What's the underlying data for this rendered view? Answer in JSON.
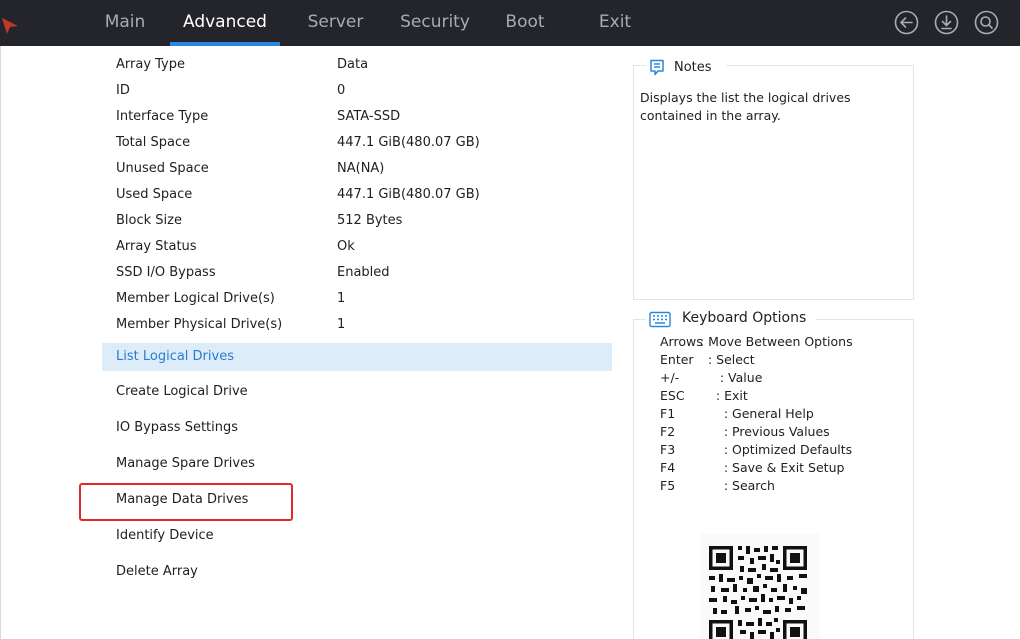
{
  "nav": {
    "tabs": [
      {
        "label": "Main",
        "active": false
      },
      {
        "label": "Advanced",
        "active": true
      },
      {
        "label": "Server",
        "active": false
      },
      {
        "label": "Security",
        "active": false
      },
      {
        "label": "Boot",
        "active": false
      },
      {
        "label": "Exit",
        "active": false
      }
    ],
    "icons": [
      "back-icon",
      "download-icon",
      "search-icon"
    ],
    "accent": "#2b86e0"
  },
  "info": [
    {
      "label": "Array Type",
      "value": "Data"
    },
    {
      "label": "ID",
      "value": "0"
    },
    {
      "label": "Interface Type",
      "value": "SATA-SSD"
    },
    {
      "label": "Total Space",
      "value": "447.1 GiB(480.07 GB)"
    },
    {
      "label": "Unused Space",
      "value": "NA(NA)"
    },
    {
      "label": "Used Space",
      "value": "447.1 GiB(480.07 GB)"
    },
    {
      "label": "Block Size",
      "value": "512 Bytes"
    },
    {
      "label": "Array Status",
      "value": "Ok"
    },
    {
      "label": "SSD I/O Bypass",
      "value": "Enabled"
    },
    {
      "label": "Member Logical Drive(s)",
      "value": "1"
    },
    {
      "label": "Member Physical Drive(s)",
      "value": "1"
    }
  ],
  "menu": [
    {
      "label": "List Logical Drives",
      "selected": true
    },
    {
      "label": "Create Logical Drive",
      "selected": false
    },
    {
      "label": "IO Bypass Settings",
      "selected": false
    },
    {
      "label": "Manage Spare Drives",
      "selected": false
    },
    {
      "label": "Manage Data Drives",
      "selected": false
    },
    {
      "label": "Identify Device",
      "selected": false
    },
    {
      "label": "Delete Array",
      "selected": false
    }
  ],
  "notes": {
    "title": "Notes",
    "text": "Displays the list the logical drives contained in the array."
  },
  "keyboard": {
    "title": "Keyboard Options",
    "items": [
      {
        "key": "Arrows",
        "desc": ": Move Between Options"
      },
      {
        "key": "Enter",
        "desc": "  : Select"
      },
      {
        "key": "+/-",
        "desc": "     : Value"
      },
      {
        "key": "ESC",
        "desc": "    : Exit"
      },
      {
        "key": "F1",
        "desc": "      : General Help"
      },
      {
        "key": "F2",
        "desc": "      : Previous Values"
      },
      {
        "key": "F3",
        "desc": "      : Optimized Defaults"
      },
      {
        "key": "F4",
        "desc": "      : Save & Exit Setup"
      },
      {
        "key": "F5",
        "desc": "      : Search"
      }
    ]
  }
}
